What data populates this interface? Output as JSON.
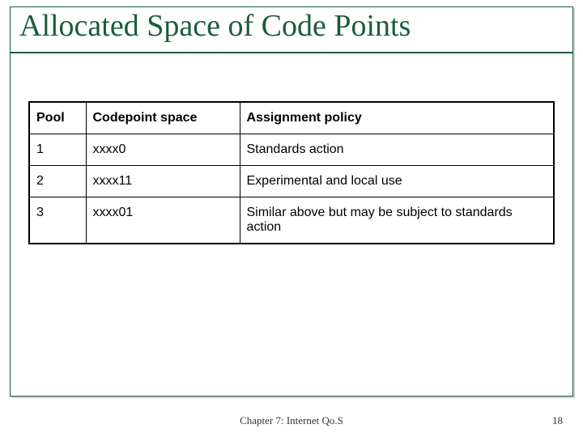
{
  "title": "Allocated Space of Code Points",
  "table": {
    "headers": {
      "pool": "Pool",
      "codepoint": "Codepoint space",
      "assignment": "Assignment policy"
    },
    "rows": [
      {
        "pool": "1",
        "codepoint": "xxxx0",
        "assignment": "Standards action"
      },
      {
        "pool": "2",
        "codepoint": "xxxx11",
        "assignment": "Experimental and local use"
      },
      {
        "pool": "3",
        "codepoint": "xxxx01",
        "assignment": "Similar above but may be subject to standards action"
      }
    ]
  },
  "footer": "Chapter 7: Internet Qo.S",
  "page_number": "18"
}
